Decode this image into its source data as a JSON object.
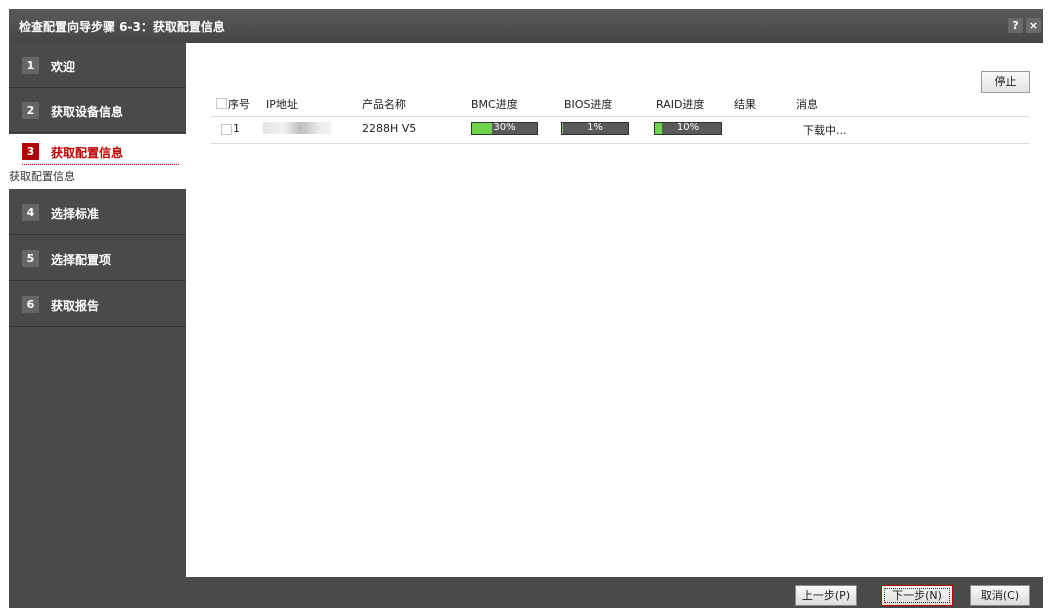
{
  "window": {
    "title": "检查配置向导步骤 6-3：获取配置信息",
    "help": "?",
    "close": "×"
  },
  "steps": [
    {
      "num": "1",
      "label": "欢迎"
    },
    {
      "num": "2",
      "label": "获取设备信息"
    },
    {
      "num": "3",
      "label": "获取配置信息",
      "sub": "获取配置信息"
    },
    {
      "num": "4",
      "label": "选择标准"
    },
    {
      "num": "5",
      "label": "选择配置项"
    },
    {
      "num": "6",
      "label": "获取报告"
    }
  ],
  "content": {
    "stop_label": "停止",
    "columns": [
      "序号",
      "IP地址",
      "产品名称",
      "BMC进度",
      "BIOS进度",
      "RAID进度",
      "结果",
      "消息"
    ],
    "row": {
      "seq": "1",
      "product": "2288H V5",
      "bmc_progress": "30%",
      "bios_progress": "1%",
      "raid_progress": "10%",
      "result": "",
      "message": "下载中..."
    }
  },
  "progress_values": {
    "bmc": 0.3,
    "bios": 0.01,
    "raid": 0.1
  },
  "colors": {
    "accent": "#c00000",
    "progress_fill": "#6fd34e",
    "sidebar": "#4a4a4a"
  },
  "footer": {
    "prev": "上一步(P)",
    "next": "下一步(N)",
    "cancel": "取消(C)"
  }
}
